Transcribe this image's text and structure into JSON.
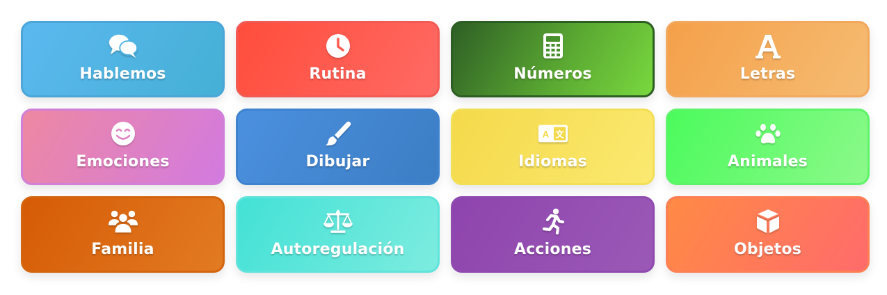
{
  "categories": [
    {
      "label": "Hablemos",
      "icon": "chat-bubbles-icon",
      "color": "#4fb3e4"
    },
    {
      "label": "Rutina",
      "icon": "clock-icon",
      "color": "#ff5a50"
    },
    {
      "label": "Números",
      "icon": "calculator-icon",
      "color": "#4a8f2e"
    },
    {
      "label": "Letras",
      "icon": "letter-a-icon",
      "color": "#f5ad5e"
    },
    {
      "label": "Emociones",
      "icon": "smiley-icon",
      "color": "#e083c2"
    },
    {
      "label": "Dibujar",
      "icon": "paintbrush-icon",
      "color": "#4588d2"
    },
    {
      "label": "Idiomas",
      "icon": "language-icon",
      "color": "#f8e15c"
    },
    {
      "label": "Animales",
      "icon": "paw-icon",
      "color": "#6bfa72"
    },
    {
      "label": "Familia",
      "icon": "family-icon",
      "color": "#dc6b14"
    },
    {
      "label": "Autoregulación",
      "icon": "balance-scale-icon",
      "color": "#5ee6da"
    },
    {
      "label": "Acciones",
      "icon": "running-person-icon",
      "color": "#954fb1"
    },
    {
      "label": "Objetos",
      "icon": "cube-icon",
      "color": "#ff7c58"
    }
  ]
}
